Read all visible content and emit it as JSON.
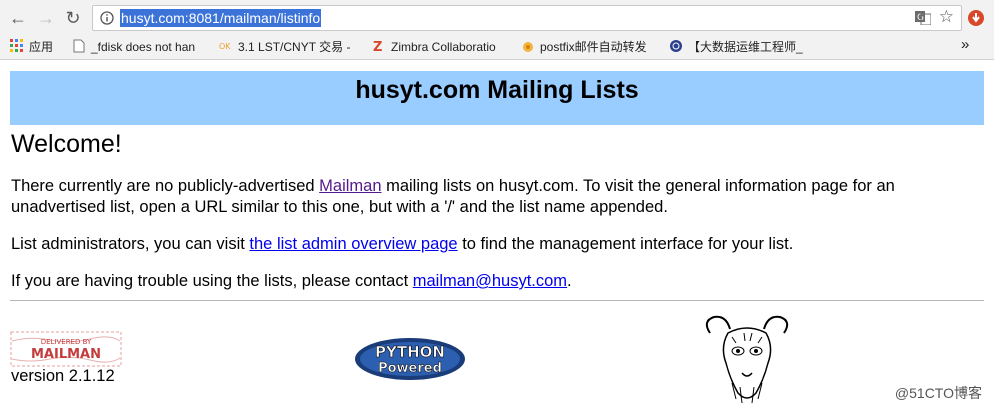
{
  "browser": {
    "url": "husyt.com:8081/mailman/listinfo",
    "bookmarks": [
      {
        "label": "应用"
      },
      {
        "label": "_fdisk does not han"
      },
      {
        "label": "3.1 LST/CNYT 交易 -"
      },
      {
        "label": "Zimbra Collaboratio"
      },
      {
        "label": "postfix邮件自动转发"
      },
      {
        "label": "【大数据运维工程师_"
      }
    ],
    "overflow": "»"
  },
  "page": {
    "title": "husyt.com Mailing Lists",
    "welcome": "Welcome!",
    "p1_before": "There currently are no publicly-advertised ",
    "p1_link": "Mailman",
    "p1_after": " mailing lists on husyt.com. To visit the general information page for an unadvertised list, open a URL similar to this one, but with a '/' and the list name appended.",
    "p2_before": "List administrators, you can visit ",
    "p2_link": "the list admin overview page",
    "p2_after": " to find the management interface for your list.",
    "p3_before": "If you are having trouble using the lists, please contact ",
    "p3_link": "mailman@husyt.com",
    "p3_after": ".",
    "logos": {
      "mailman_line1": "DELIVERED BY",
      "mailman_line2": "MAILMAN",
      "python_line1": "PYTHON",
      "python_line2": "Powered"
    },
    "version": "version 2.1.12",
    "watermark": "@51CTO博客"
  }
}
